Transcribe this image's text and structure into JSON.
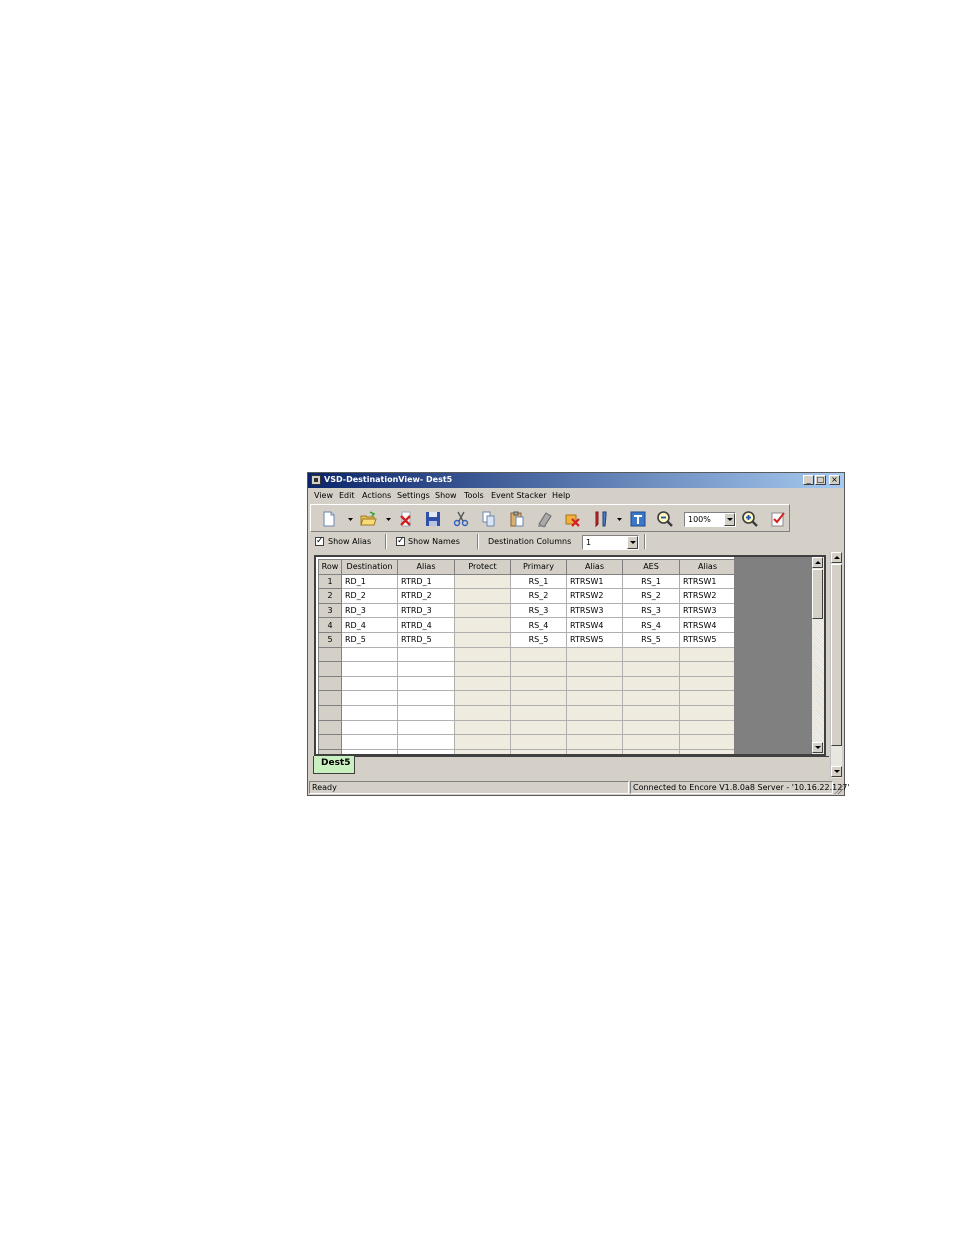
{
  "window": {
    "title": "VSD-DestinationView- Dest5"
  },
  "menu": [
    "View",
    "Edit",
    "Actions",
    "Settings",
    "Show",
    "Tools",
    "Event Stacker",
    "Help"
  ],
  "toolbar": {
    "zoom_value": "100%"
  },
  "options": {
    "show_alias_label": "Show Alias",
    "show_alias_checked": true,
    "show_names_label": "Show Names",
    "show_names_checked": true,
    "dest_columns_label": "Destination Columns",
    "dest_columns_value": "1"
  },
  "grid": {
    "headers": [
      "Row",
      "Destination",
      "Alias",
      "Protect",
      "Primary",
      "Alias",
      "AES",
      "Alias"
    ],
    "rows": [
      [
        "1",
        "RD_1",
        "RTRD_1",
        "",
        "RS_1",
        "RTRSW1",
        "RS_1",
        "RTRSW1"
      ],
      [
        "2",
        "RD_2",
        "RTRD_2",
        "",
        "RS_2",
        "RTRSW2",
        "RS_2",
        "RTRSW2"
      ],
      [
        "3",
        "RD_3",
        "RTRD_3",
        "",
        "RS_3",
        "RTRSW3",
        "RS_3",
        "RTRSW3"
      ],
      [
        "4",
        "RD_4",
        "RTRD_4",
        "",
        "RS_4",
        "RTRSW4",
        "RS_4",
        "RTRSW4"
      ],
      [
        "5",
        "RD_5",
        "RTRD_5",
        "",
        "RS_5",
        "RTRSW5",
        "RS_5",
        "RTRSW5"
      ]
    ],
    "empty_rows": 8
  },
  "tabs": [
    {
      "label": "Dest5",
      "active": true,
      "color": "#c8f0c0"
    }
  ],
  "status": {
    "left": "Ready",
    "right": "Connected to Encore V1.8.0a8 Server - '10.16.22.127'"
  },
  "icons": [
    "new-icon",
    "open-icon",
    "delete-icon",
    "save-icon",
    "cut-icon",
    "copy-icon",
    "paste-icon",
    "clear-icon",
    "remove-icon",
    "tools-icon",
    "text-icon",
    "zoom-out-icon",
    "zoom-in-icon",
    "checklist-icon"
  ]
}
